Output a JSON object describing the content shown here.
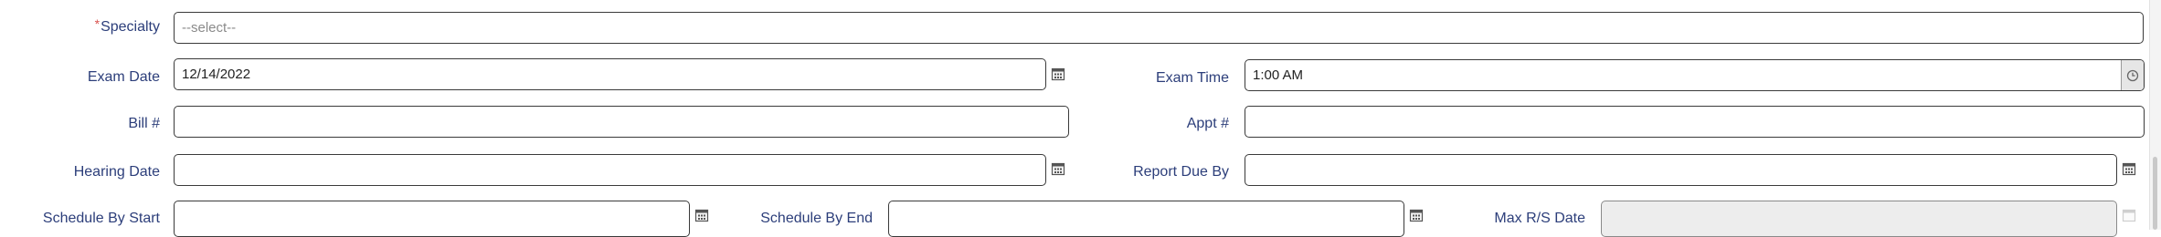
{
  "form": {
    "specialty": {
      "label": "Specialty",
      "required_mark": "*",
      "placeholder": "--select--"
    },
    "exam_date": {
      "label": "Exam Date",
      "value": "12/14/2022",
      "icon": "calendar-icon"
    },
    "exam_time": {
      "label": "Exam Time",
      "value": "1:00 AM",
      "icon": "clock-icon"
    },
    "bill_number": {
      "label": "Bill #",
      "value": ""
    },
    "appt_number": {
      "label": "Appt #",
      "value": ""
    },
    "hearing_date": {
      "label": "Hearing Date",
      "value": "",
      "icon": "calendar-icon"
    },
    "report_due_by": {
      "label": "Report Due By",
      "value": "",
      "icon": "calendar-icon"
    },
    "schedule_by_start": {
      "label": "Schedule By Start",
      "value": "",
      "icon": "calendar-icon"
    },
    "schedule_by_end": {
      "label": "Schedule By End",
      "value": "",
      "icon": "calendar-icon"
    },
    "max_rs_date": {
      "label": "Max R/S Date",
      "value": "",
      "disabled": true,
      "icon": "calendar-icon"
    }
  },
  "colors": {
    "label": "#2c3e7a",
    "required": "#d9534f",
    "border": "#3a3a3a",
    "disabled_bg": "#ededed"
  }
}
